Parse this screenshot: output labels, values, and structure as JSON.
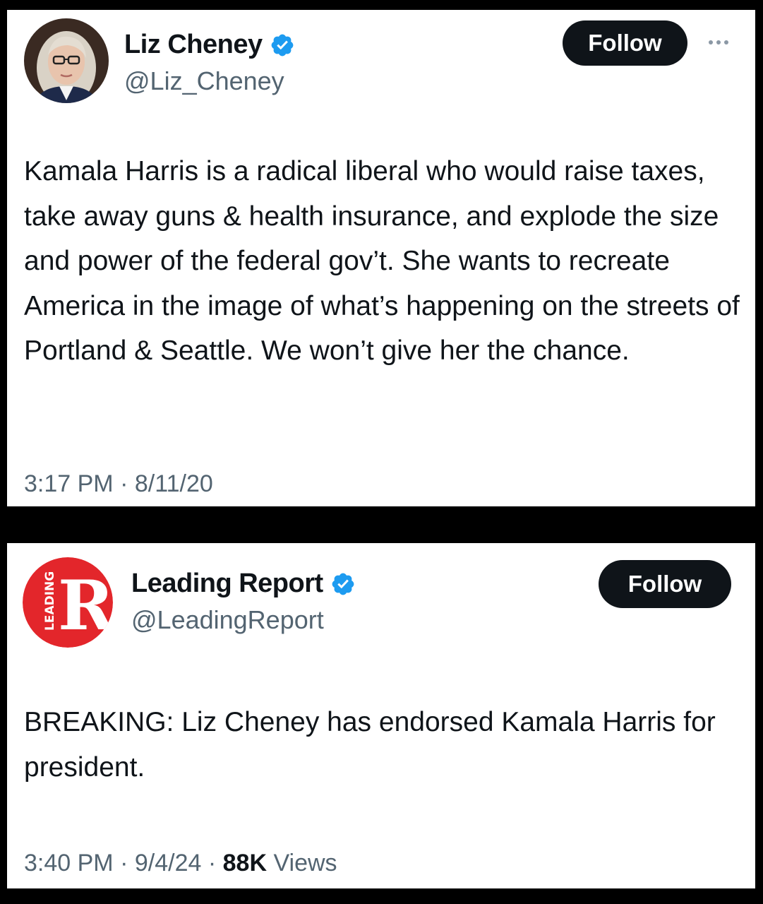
{
  "tweets": [
    {
      "author": {
        "name": "Liz Cheney",
        "handle": "@Liz_Cheney",
        "verified": true,
        "avatar_icon": "profile-photo"
      },
      "follow_label": "Follow",
      "more_icon": "more-options-icon",
      "text": "Kamala Harris is a radical liberal who would raise taxes, take away guns & health insurance, and explode the size and power of the federal gov’t. She wants to recreate America in the image of what’s happening on the streets of Portland & Seattle. We won’t give her the chance.",
      "time": "3:17 PM",
      "date": "8/11/20"
    },
    {
      "author": {
        "name": "Leading Report",
        "handle": "@LeadingReport",
        "verified": true,
        "avatar_icon": "leading-report-logo",
        "logo_letter": "R",
        "logo_text": "LEADING"
      },
      "follow_label": "Follow",
      "text": "BREAKING: Liz Cheney has endorsed Kamala Harris for president.",
      "time": "3:40 PM",
      "date": "9/4/24",
      "views_count": "88K",
      "views_label": "Views"
    }
  ],
  "separator": "·",
  "colors": {
    "background": "#000000",
    "card": "#ffffff",
    "text": "#0f1419",
    "secondary_text": "#536471",
    "verified_badge": "#1d9bf0",
    "follow_button": "#0f1419",
    "logo_red": "#e3262b"
  }
}
